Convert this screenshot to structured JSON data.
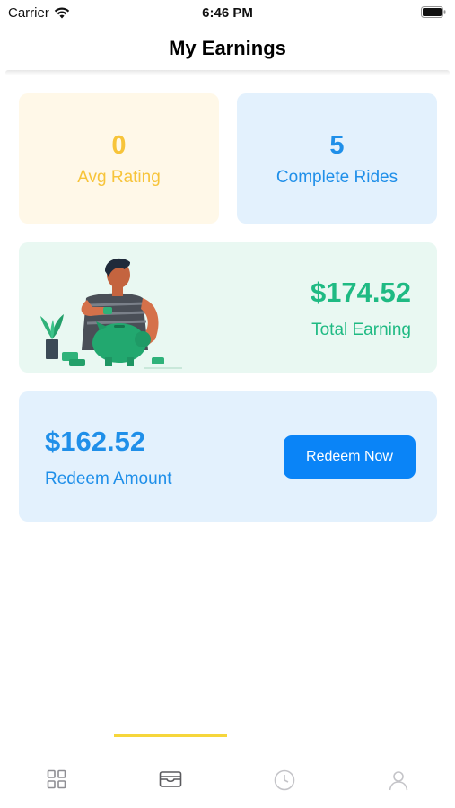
{
  "status_bar": {
    "carrier": "Carrier",
    "time": "6:46 PM"
  },
  "header": {
    "title": "My Earnings"
  },
  "stats": {
    "avg_rating": {
      "value": "0",
      "label": "Avg Rating",
      "color": "#f7c43a"
    },
    "complete_rides": {
      "value": "5",
      "label": "Complete Rides",
      "color": "#1f8fe9"
    }
  },
  "total_earning": {
    "value": "$174.52",
    "label": "Total Earning",
    "color": "#1fba83",
    "illustration": "man-with-piggy-bank-illustration"
  },
  "redeem": {
    "value": "$162.52",
    "label": "Redeem Amount",
    "button_label": "Redeem Now",
    "button_color": "#0a84f7"
  },
  "tab_bar": {
    "active_index": 1,
    "indicator_color": "#f6d63b",
    "tabs": [
      {
        "icon": "grid-icon"
      },
      {
        "icon": "wallet-icon"
      },
      {
        "icon": "clock-icon"
      },
      {
        "icon": "profile-icon"
      }
    ]
  }
}
